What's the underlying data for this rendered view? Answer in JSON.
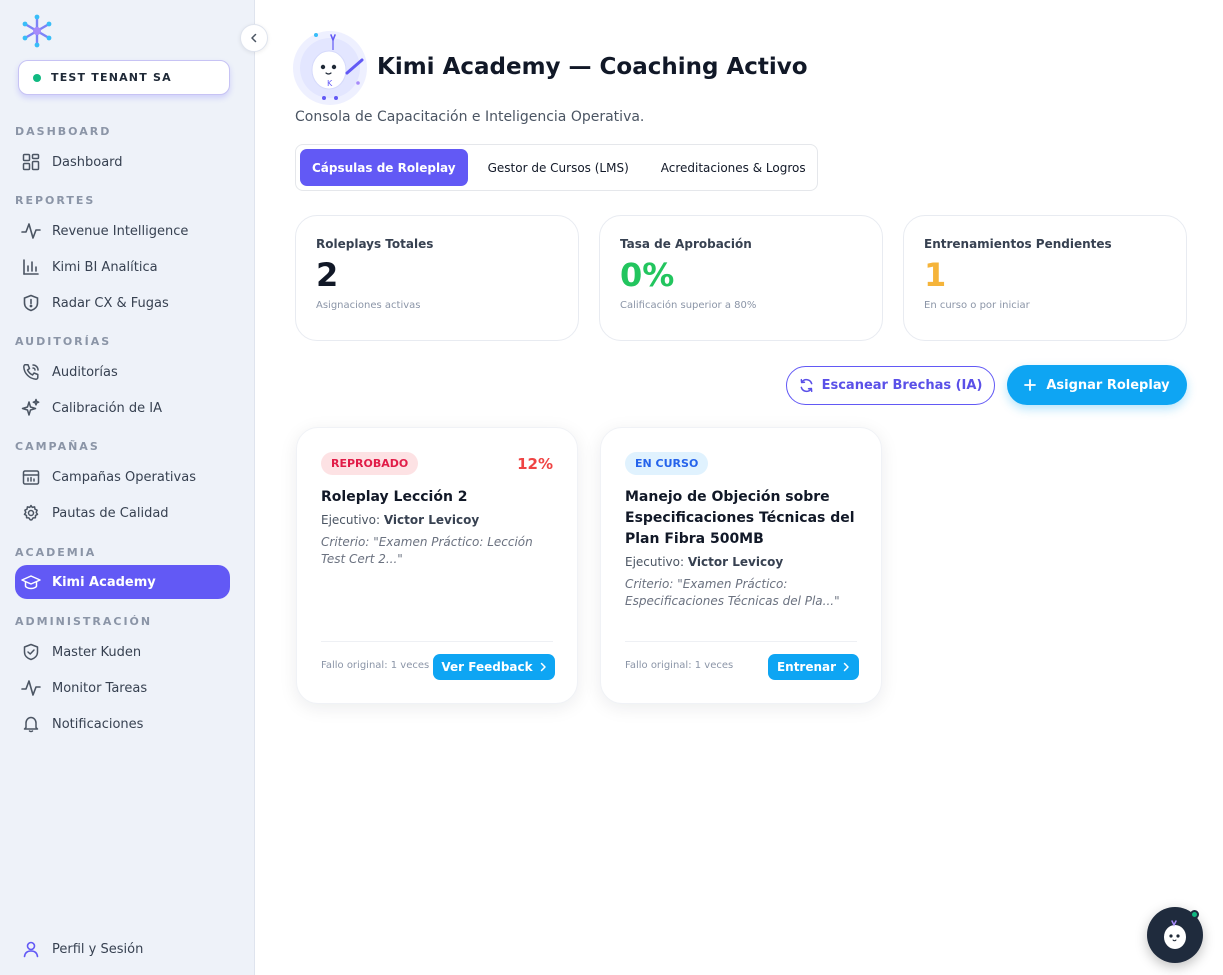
{
  "sidebar": {
    "tenant": "TEST TENANT SA",
    "sections": [
      {
        "label": "DASHBOARD",
        "items": [
          {
            "label": "Dashboard",
            "icon": "grid-icon"
          }
        ]
      },
      {
        "label": "REPORTES",
        "items": [
          {
            "label": "Revenue Intelligence",
            "icon": "activity-icon"
          },
          {
            "label": "Kimi BI Analítica",
            "icon": "bar-chart-icon"
          },
          {
            "label": "Radar CX & Fugas",
            "icon": "shield-alert-icon"
          }
        ]
      },
      {
        "label": "AUDITORÍAS",
        "items": [
          {
            "label": "Auditorías",
            "icon": "phone-icon"
          },
          {
            "label": "Calibración de IA",
            "icon": "sparkles-icon"
          }
        ]
      },
      {
        "label": "CAMPAÑAS",
        "items": [
          {
            "label": "Campañas Operativas",
            "icon": "calendar-icon"
          },
          {
            "label": "Pautas de Calidad",
            "icon": "gear-icon"
          }
        ]
      },
      {
        "label": "ACADEMIA",
        "items": [
          {
            "label": "Kimi Academy",
            "icon": "graduation-cap-icon",
            "active": true
          }
        ]
      },
      {
        "label": "ADMINISTRACIÓN",
        "items": [
          {
            "label": "Master Kuden",
            "icon": "shield-check-icon"
          },
          {
            "label": "Monitor Tareas",
            "icon": "activity-icon"
          },
          {
            "label": "Notificaciones",
            "icon": "bell-icon"
          }
        ]
      }
    ],
    "profile": "Perfil y Sesión"
  },
  "header": {
    "title": "Kimi Academy — Coaching Activo",
    "subtitle": "Consola de Capacitación e Inteligencia Operativa."
  },
  "tabs": [
    "Cápsulas de Roleplay",
    "Gestor de Cursos (LMS)",
    "Acreditaciones & Logros"
  ],
  "stats": [
    {
      "label": "Roleplays Totales",
      "value": "2",
      "sub": "Asignaciones activas",
      "color": "#111827"
    },
    {
      "label": "Tasa de Aprobación",
      "value": "0%",
      "sub": "Calificación superior a 80%",
      "color": "#22c55e"
    },
    {
      "label": "Entrenamientos Pendientes",
      "value": "1",
      "sub": "En curso o por iniciar",
      "color": "#f5b43a"
    }
  ],
  "actions": {
    "scan": "Escanear Brechas (IA)",
    "assign": "Asignar Roleplay"
  },
  "cards": [
    {
      "badge": "REPROBADO",
      "score": "12%",
      "title": "Roleplay Lección 2",
      "exec_label": "Ejecutivo:",
      "exec_name": "Victor Levicoy",
      "criteria": "Criterio: \"Examen Práctico: Lección Test Cert 2...\"",
      "fail": "Fallo original: 1 veces",
      "button": "Ver Feedback"
    },
    {
      "badge": "EN CURSO",
      "title": "Manejo de Objeción sobre Especificaciones Técnicas del Plan Fibra 500MB",
      "exec_label": "Ejecutivo:",
      "exec_name": "Victor Levicoy",
      "criteria": "Criterio: \"Examen Práctico: Especificaciones Técnicas del Pla...\"",
      "fail": "Fallo original: 1 veces",
      "button": "Entrenar"
    }
  ]
}
